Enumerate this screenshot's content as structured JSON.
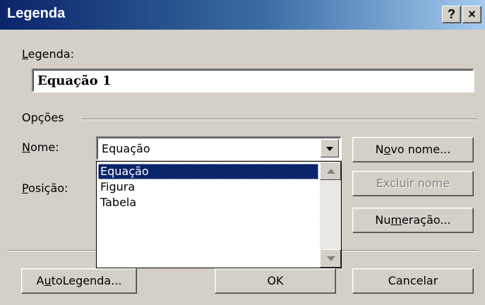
{
  "window": {
    "title": "Legenda",
    "help_label": "?",
    "close_label": "×"
  },
  "caption": {
    "label_accel": "L",
    "label_rest": "egenda:",
    "value": "Equação 1"
  },
  "options": {
    "group_label": "Opções",
    "name_label_accel": "N",
    "name_label_rest": "ome:",
    "name_value": "Equação",
    "name_options": [
      "Equação",
      "Figura",
      "Tabela"
    ],
    "selected_index": 0,
    "position_label_accel": "P",
    "position_label_rest": "osição:"
  },
  "buttons": {
    "new_name_pre": "N",
    "new_name_accel": "o",
    "new_name_post": "vo nome...",
    "delete_name": "Excluir nome",
    "numbering_pre": "Nu",
    "numbering_accel": "m",
    "numbering_post": "eração...",
    "autocaption_pre": "A",
    "autocaption_accel": "u",
    "autocaption_post": "toLegenda...",
    "ok": "OK",
    "cancel": "Cancelar"
  },
  "icons": {
    "dropdown": "chevron-down-icon",
    "scroll_up": "triangle-up-icon",
    "scroll_down": "triangle-down-icon"
  }
}
